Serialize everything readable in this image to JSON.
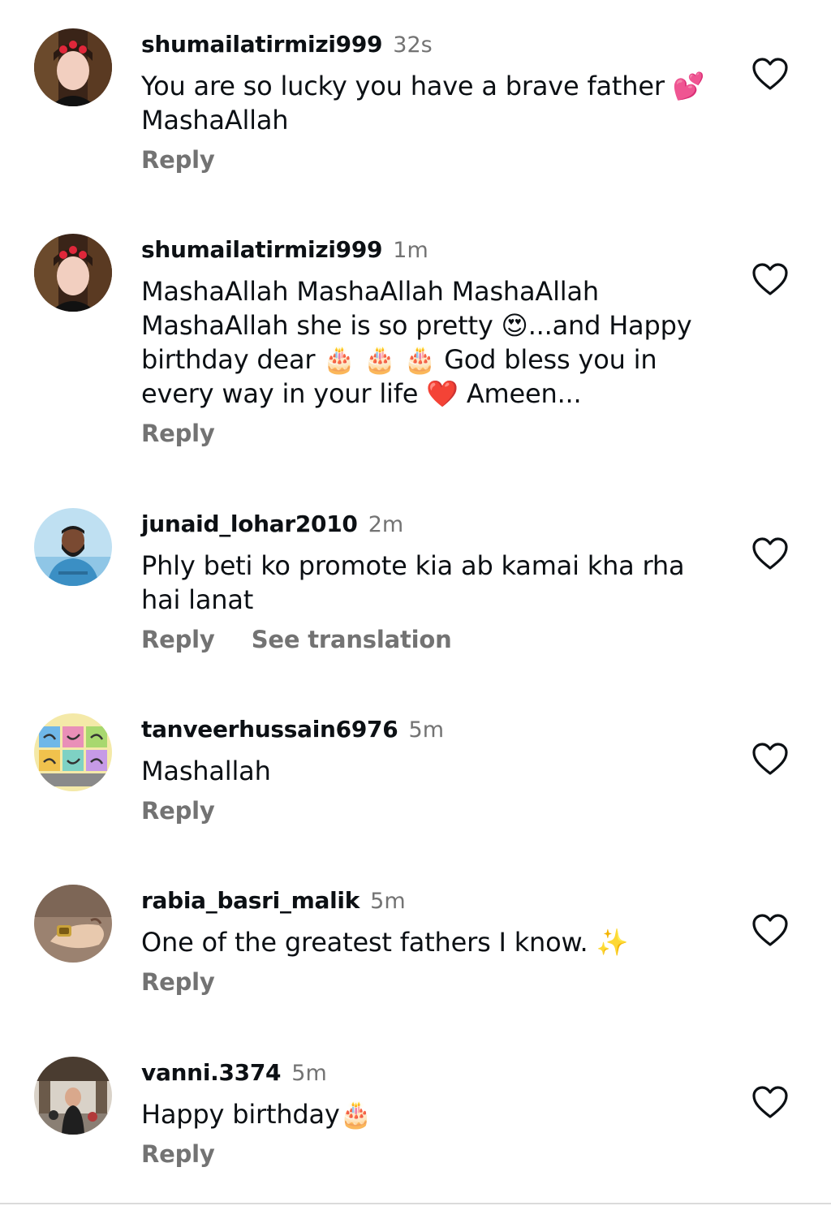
{
  "comments": [
    {
      "username": "shumailatirmizi999",
      "time": "32s",
      "text": "You are so lucky you have a brave  father 💕 MashaAllah",
      "reply_label": "Reply",
      "avatar_icon": "avatar-photo-girl"
    },
    {
      "username": "shumailatirmizi999",
      "time": "1m",
      "text": "MashaAllah MashaAllah MashaAllah MashaAllah she is so pretty 😍...and Happy birthday dear 🎂 🎂 🎂 God bless you in every way in your life ❤️ Ameen...",
      "reply_label": "Reply",
      "avatar_icon": "avatar-photo-girl"
    },
    {
      "username": "junaid_lohar2010",
      "time": "2m",
      "text": "Phly beti ko promote kia ab kamai kha rha hai lanat",
      "reply_label": "Reply",
      "translate_label": "See translation",
      "avatar_icon": "avatar-photo-man"
    },
    {
      "username": "tanveerhussain6976",
      "time": "5m",
      "text": "Mashallah",
      "reply_label": "Reply",
      "avatar_icon": "avatar-calligraphy"
    },
    {
      "username": "rabia_basri_malik",
      "time": "5m",
      "text": "One of the greatest fathers I know. ✨",
      "reply_label": "Reply",
      "avatar_icon": "avatar-photo-hand"
    },
    {
      "username": "vanni.3374",
      "time": "5m",
      "text": "Happy birthday🎂",
      "reply_label": "Reply",
      "avatar_icon": "avatar-photo-street"
    }
  ],
  "icons": {
    "like": "heart-outline-icon"
  },
  "colors": {
    "text": "#0c1014",
    "secondary": "#737373",
    "divider": "#dbdbdb"
  }
}
